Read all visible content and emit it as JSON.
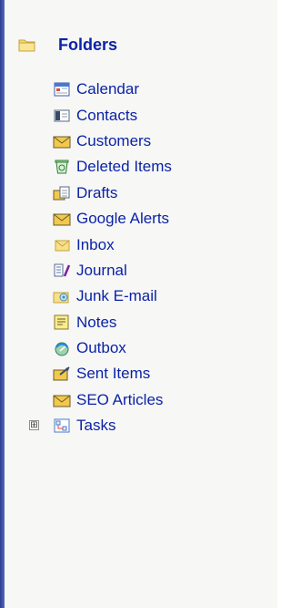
{
  "root": {
    "label": "Folders",
    "icon": "folder-icon"
  },
  "folders": [
    {
      "label": "Calendar",
      "icon": "calendar-icon"
    },
    {
      "label": "Contacts",
      "icon": "contacts-icon"
    },
    {
      "label": "Customers",
      "icon": "mail-folder-icon"
    },
    {
      "label": "Deleted Items",
      "icon": "trash-icon"
    },
    {
      "label": "Drafts",
      "icon": "drafts-icon"
    },
    {
      "label": "Google Alerts",
      "icon": "mail-folder-icon"
    },
    {
      "label": "Inbox",
      "icon": "inbox-icon"
    },
    {
      "label": "Journal",
      "icon": "journal-icon"
    },
    {
      "label": "Junk E-mail",
      "icon": "junk-mail-icon"
    },
    {
      "label": "Notes",
      "icon": "notes-icon"
    },
    {
      "label": "Outbox",
      "icon": "outbox-icon"
    },
    {
      "label": "Sent Items",
      "icon": "sent-items-icon"
    },
    {
      "label": "SEO Articles",
      "icon": "mail-folder-icon"
    },
    {
      "label": "Tasks",
      "icon": "tasks-icon",
      "expander": "⊞"
    }
  ],
  "colors": {
    "label": "#0b23a8",
    "background": "#f7f7f5",
    "accent_bar": "#2b3e94"
  }
}
